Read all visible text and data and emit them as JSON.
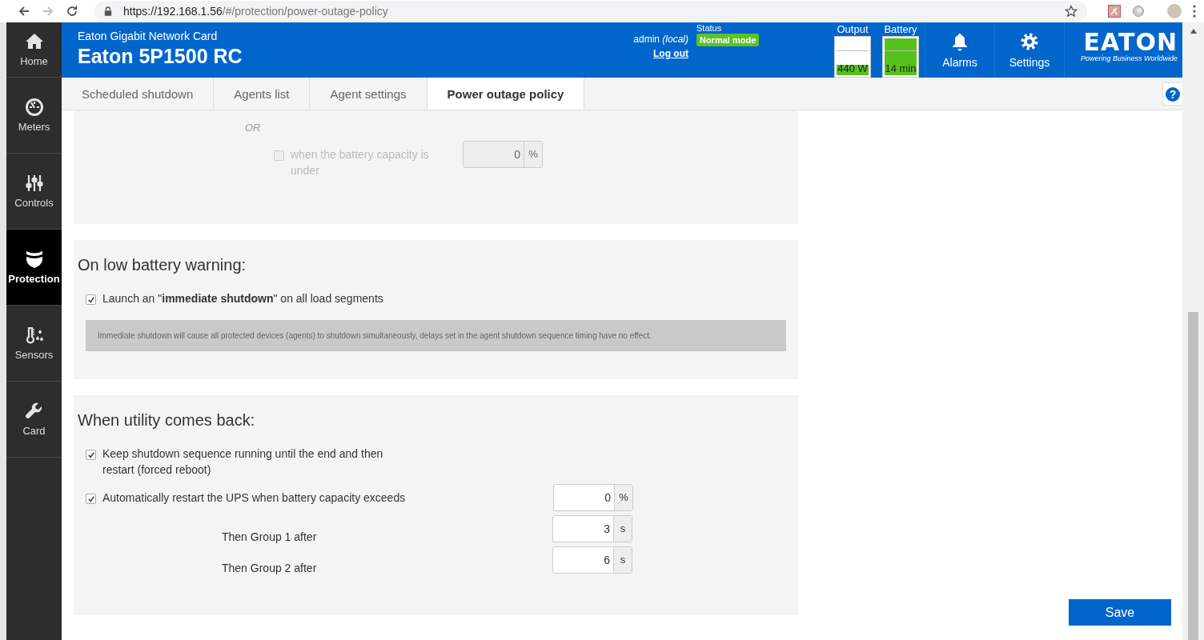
{
  "browser": {
    "url_host": "https://192.168.1.56",
    "url_path": "/#/protection/power-outage-policy"
  },
  "sidebar": {
    "items": [
      {
        "label": "Home",
        "kind": "home",
        "selected": false
      },
      {
        "label": "Meters",
        "kind": "meters",
        "selected": false
      },
      {
        "label": "Controls",
        "kind": "controls",
        "selected": false
      },
      {
        "label": "Protection",
        "kind": "protection",
        "selected": true
      },
      {
        "label": "Sensors",
        "kind": "sensors",
        "selected": false
      },
      {
        "label": "Card",
        "kind": "card",
        "selected": false
      }
    ]
  },
  "header": {
    "subtitle": "Eaton Gigabit Network Card",
    "title": "Eaton 5P1500 RC",
    "user": "admin",
    "user_scope": "(local)",
    "logout": "Log out",
    "status_label": "Status",
    "status": "Normal mode",
    "meters": [
      {
        "label": "Output",
        "reading": "440 W",
        "level": 0.28
      },
      {
        "label": "Battery",
        "reading": "14 min",
        "level": 1
      }
    ],
    "buttons": [
      {
        "label": "Alarms",
        "kind": "bell"
      },
      {
        "label": "Settings",
        "kind": "gear"
      }
    ],
    "logo": "EATON",
    "tagline": "Powering Business Worldwide"
  },
  "tabs": [
    {
      "label": "Scheduled shutdown",
      "selected": false
    },
    {
      "label": "Agents list",
      "selected": false
    },
    {
      "label": "Agent settings",
      "selected": false
    },
    {
      "label": "Power outage policy",
      "selected": true
    }
  ],
  "help_button": "?",
  "sections": [
    {
      "items": [
        {
          "kind": "or",
          "label": "OR"
        },
        {
          "kind": "checkbox_field",
          "label": "when the battery capacity is under",
          "checked": false,
          "disabled": true,
          "value": "0",
          "unit": "%"
        }
      ]
    },
    {
      "heading": "On low battery warning:",
      "items": [
        {
          "kind": "checkbox",
          "label": "Launch an \"**immediate shutdown**\" on all load segments",
          "checked": true
        },
        {
          "kind": "note",
          "label": "Immediate shutdown will cause all protected devices (agents) to shutdown simultaneously, delays set in the agent shutdown sequence timing have no effect."
        }
      ]
    },
    {
      "heading": "When utility comes back:",
      "items": [
        {
          "kind": "checkbox",
          "label": "Keep shutdown sequence running until the end and then restart (forced reboot)",
          "checked": true
        },
        {
          "kind": "checkbox_field",
          "label": "Automatically restart the UPS when battery capacity exceeds",
          "checked": true,
          "disabled": false,
          "value": "0",
          "unit": "%"
        },
        {
          "kind": "field",
          "label": "Then Group 1 after",
          "value": "3",
          "unit": "s"
        },
        {
          "kind": "field",
          "label": "Then Group 2 after",
          "value": "6",
          "unit": "s"
        }
      ]
    }
  ],
  "save": "Save"
}
